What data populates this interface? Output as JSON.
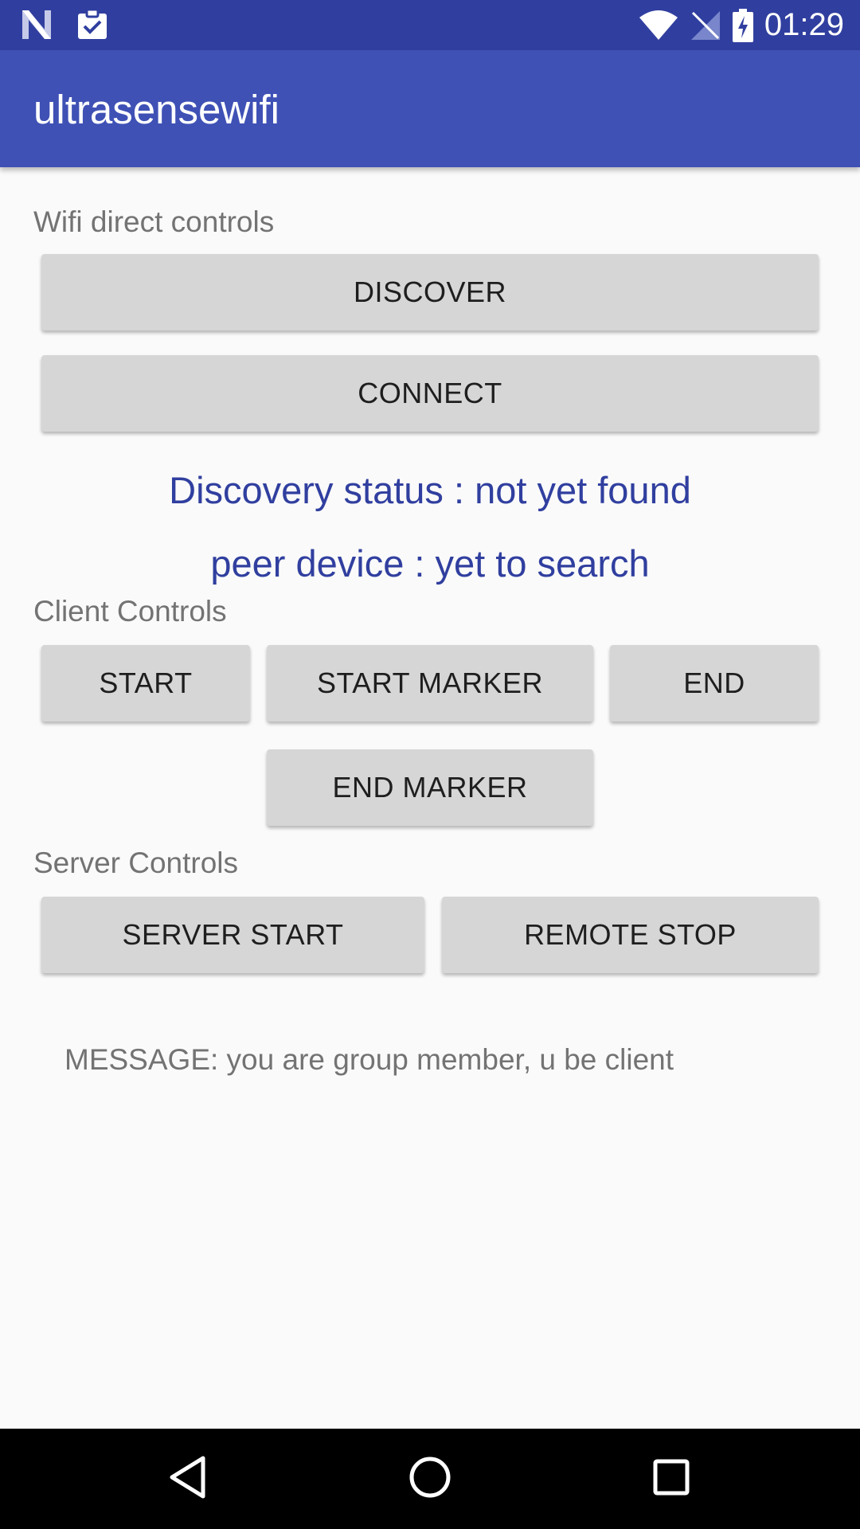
{
  "status_bar": {
    "time": "01:29",
    "icons_left": [
      "n-logo-icon",
      "clipboard-check-icon"
    ],
    "icons_right": [
      "wifi-icon",
      "no-signal-icon",
      "battery-charging-icon"
    ]
  },
  "app_bar": {
    "title": "ultrasensewifi"
  },
  "wifi_section": {
    "label": "Wifi direct controls",
    "discover_label": "DISCOVER",
    "connect_label": "CONNECT"
  },
  "status": {
    "discovery": "Discovery status : not yet found",
    "peer": "peer device : yet to search"
  },
  "client_section": {
    "label": "Client Controls",
    "start_label": "START",
    "start_marker_label": "START MARKER",
    "end_label": "END",
    "end_marker_label": "END MARKER"
  },
  "server_section": {
    "label": "Server Controls",
    "server_start_label": "SERVER START",
    "remote_stop_label": "REMOTE STOP"
  },
  "message": "MESSAGE: you are group member, u be client",
  "nav_bar": {
    "icons": [
      "back-icon",
      "home-icon",
      "recents-icon"
    ]
  },
  "colors": {
    "status_bar": "#303f9f",
    "app_bar": "#3f51b5",
    "accent_text": "#303f9f",
    "button": "#d6d6d6"
  }
}
